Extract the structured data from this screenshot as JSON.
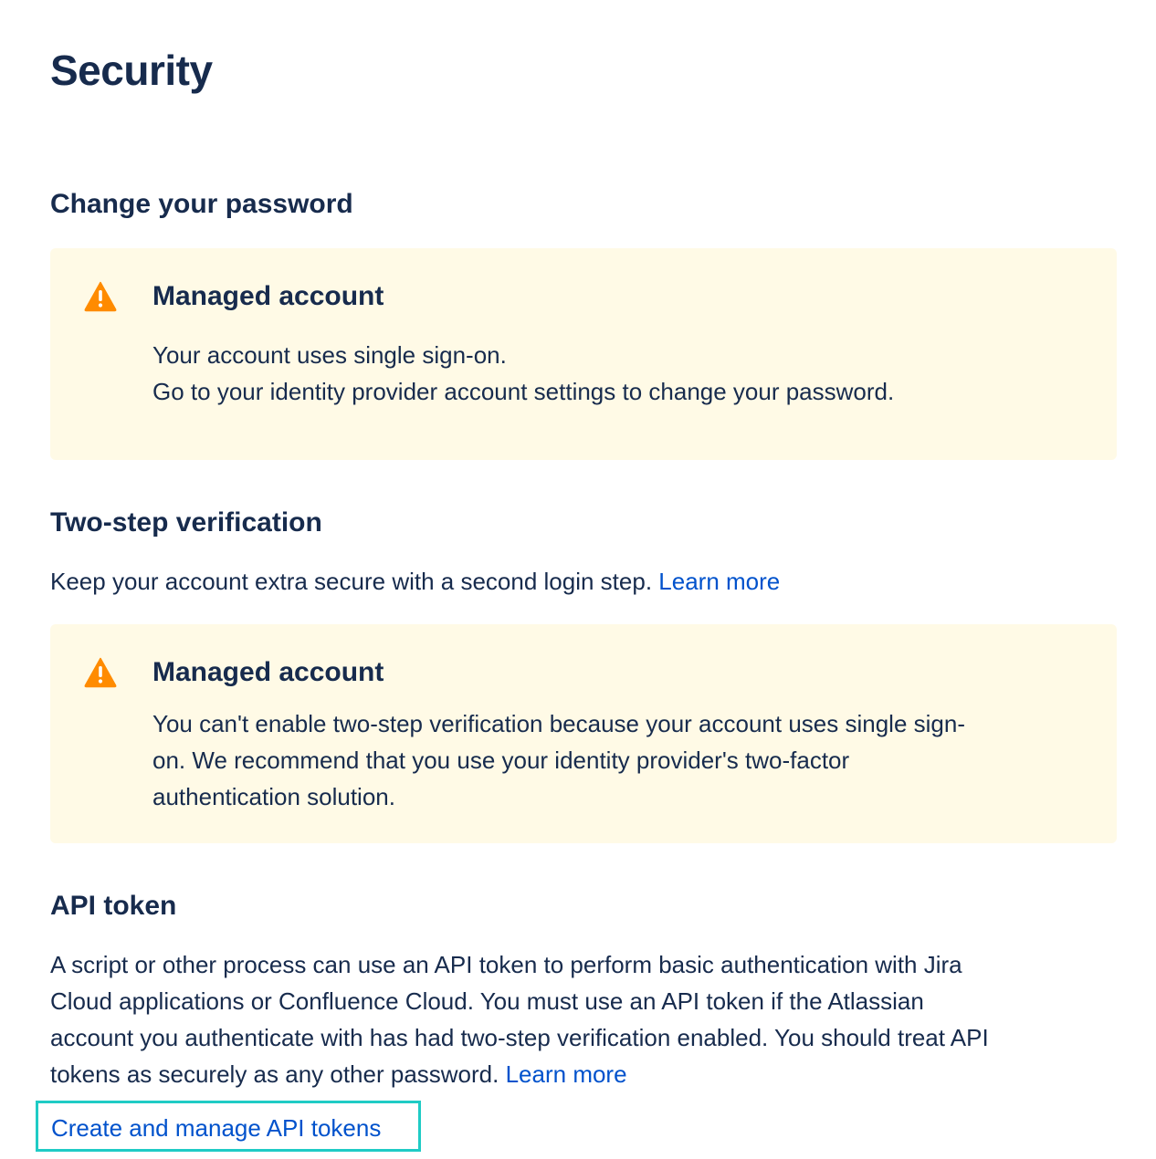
{
  "page": {
    "title": "Security"
  },
  "password": {
    "heading": "Change your password",
    "panel": {
      "title": "Managed account",
      "lines": [
        "Your account uses single sign-on.",
        "Go to your identity provider account settings to change your password."
      ]
    }
  },
  "two_step": {
    "heading": "Two-step verification",
    "description": "Keep your account extra secure with a second login step.",
    "learn_more": "Learn more",
    "panel": {
      "title": "Managed account",
      "lines": [
        "You can't enable two-step verification because your account uses single sign-",
        "on. We recommend that you use your identity provider's two-factor",
        "authentication solution."
      ]
    }
  },
  "api_token": {
    "heading": "API token",
    "lines": [
      "A script or other process can use an API token to perform basic authentication with Jira",
      "Cloud applications or Confluence Cloud. You must use an API token if the Atlassian",
      "account you authenticate with has had two-step verification enabled. You should treat API",
      "tokens as securely as any other password."
    ],
    "learn_more": "Learn more",
    "manage_link": "Create and manage API tokens"
  },
  "icons": {
    "warning": "warning-icon"
  },
  "colors": {
    "text": "#172b4d",
    "link": "#0052cc",
    "warning_bg": "#fffae6",
    "warning_icon": "#ff8b00",
    "highlight": "#1fcbc5"
  }
}
